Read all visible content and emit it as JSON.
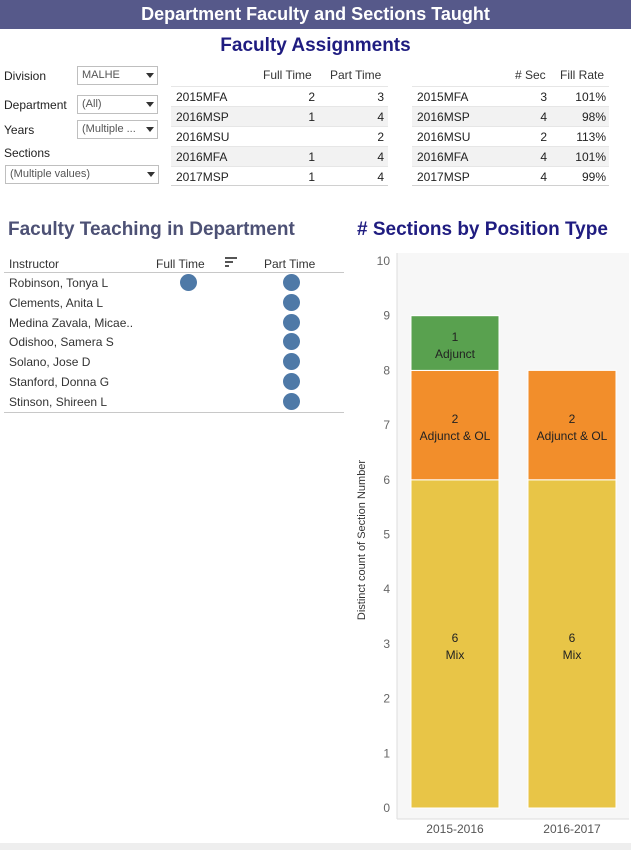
{
  "header": {
    "banner": "Department Faculty and Sections Taught",
    "subtitle": "Faculty Assignments"
  },
  "filters": {
    "division_label": "Division",
    "division_value": "MALHE",
    "department_label": "Department",
    "department_value": "(All)",
    "years_label": "Years",
    "years_value": "(Multiple ...",
    "sections_label": "Sections",
    "sections_value": "(Multiple values)"
  },
  "assignments_table": {
    "col_full": "Full Time",
    "col_part": "Part Time",
    "rows": [
      {
        "term": "2015MFA",
        "full": "2",
        "part": "3"
      },
      {
        "term": "2016MSP",
        "full": "1",
        "part": "4"
      },
      {
        "term": "2016MSU",
        "full": "",
        "part": "2"
      },
      {
        "term": "2016MFA",
        "full": "1",
        "part": "4"
      },
      {
        "term": "2017MSP",
        "full": "1",
        "part": "4"
      }
    ]
  },
  "fill_table": {
    "col_sec": "# Sec",
    "col_fill": "Fill Rate",
    "rows": [
      {
        "term": "2015MFA",
        "sec": "3",
        "fill": "101%"
      },
      {
        "term": "2016MSP",
        "sec": "4",
        "fill": "98%"
      },
      {
        "term": "2016MSU",
        "sec": "2",
        "fill": "113%"
      },
      {
        "term": "2016MFA",
        "sec": "4",
        "fill": "101%"
      },
      {
        "term": "2017MSP",
        "sec": "4",
        "fill": "99%"
      }
    ]
  },
  "faculty": {
    "title": "Faculty Teaching in Department",
    "col_instructor": "Instructor",
    "col_full": "Full Time",
    "col_part": "Part Time",
    "rows": [
      {
        "name": "Robinson, Tonya L",
        "full": true,
        "part": true
      },
      {
        "name": "Clements, Anita L",
        "full": false,
        "part": true
      },
      {
        "name": "Medina Zavala, Micae..",
        "full": false,
        "part": true
      },
      {
        "name": "Odishoo, Samera S",
        "full": false,
        "part": true
      },
      {
        "name": "Solano, Jose D",
        "full": false,
        "part": true
      },
      {
        "name": "Stanford, Donna G",
        "full": false,
        "part": true
      },
      {
        "name": "Stinson, Shireen L",
        "full": false,
        "part": true
      }
    ]
  },
  "colors": {
    "banner": "#56598a",
    "dot": "#4e79a7",
    "mix": "#e8c547",
    "adjunct_ol": "#f28e2b",
    "adjunct": "#59a14f"
  },
  "chart_data": {
    "type": "bar",
    "stacked": true,
    "title": "# Sections  by Position Type",
    "ylabel": "Distinct count of Section Number",
    "xlabel": "",
    "ylim": [
      0,
      10
    ],
    "yticks": [
      0,
      1,
      2,
      3,
      4,
      5,
      6,
      7,
      8,
      9,
      10
    ],
    "categories": [
      "2015-2016",
      "2016-2017"
    ],
    "series": [
      {
        "name": "Mix",
        "values": [
          6,
          6
        ],
        "color": "#e8c547"
      },
      {
        "name": "Adjunct & OL",
        "values": [
          2,
          2
        ],
        "color": "#f28e2b"
      },
      {
        "name": "Adjunct",
        "values": [
          1,
          0
        ],
        "color": "#59a14f"
      }
    ]
  }
}
